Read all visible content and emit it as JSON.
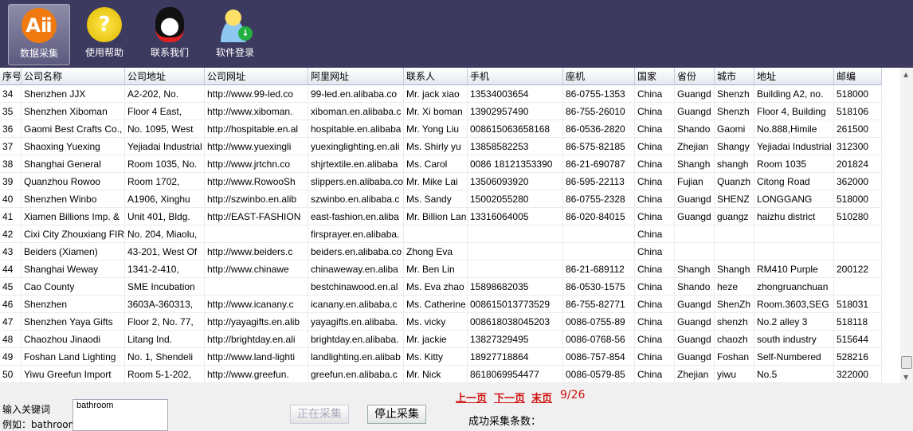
{
  "toolbar": {
    "items": [
      {
        "label": "数据采集",
        "icon": "alibaba-logo-icon"
      },
      {
        "label": "使用帮助",
        "icon": "help-question-icon"
      },
      {
        "label": "联系我们",
        "icon": "qq-penguin-icon"
      },
      {
        "label": "软件登录",
        "icon": "user-login-icon"
      }
    ]
  },
  "table": {
    "columns": [
      "序号",
      "公司名称",
      "公司地址",
      "公司网址",
      "阿里网址",
      "联系人",
      "手机",
      "座机",
      "国家",
      "省份",
      "城市",
      "地址",
      "邮编"
    ],
    "rows": [
      [
        "34",
        "Shenzhen JJX",
        "A2-202, No.",
        "http://www.99-led.co",
        "99-led.en.alibaba.co",
        "Mr. jack xiao",
        "13534003654",
        "86-0755-1353",
        "China",
        "Guangd",
        "Shenzh",
        "Building A2, no.",
        "518000"
      ],
      [
        "35",
        "Shenzhen Xiboman",
        "Floor 4 East,",
        "http://www.xiboman.",
        "xiboman.en.alibaba.c",
        "Mr. Xi boman",
        "13902957490",
        "86-755-26010",
        "China",
        "Guangd",
        "Shenzh",
        "Floor 4, Building",
        "518106"
      ],
      [
        "36",
        "Gaomi Best Crafts Co.,",
        "No. 1095, West",
        "http://hospitable.en.al",
        "hospitable.en.alibaba",
        "Mr. Yong Liu",
        "008615063658168",
        "86-0536-2820",
        "China",
        "Shando",
        "Gaomi",
        "No.888,Himile",
        "261500"
      ],
      [
        "37",
        "Shaoxing Yuexing",
        "Yejiadai Industrial",
        "http://www.yuexingli",
        "yuexinglighting.en.ali",
        "Ms. Shirly yu",
        "13858582253",
        "86-575-82185",
        "China",
        "Zhejian",
        "Shangy",
        "Yejiadai Industrial",
        "312300"
      ],
      [
        "38",
        "Shanghai General",
        "Room 1035, No.",
        "http://www.jrtchn.co",
        "shjrtextile.en.alibaba",
        "Ms. Carol",
        "0086 18121353390",
        "86-21-690787",
        "China",
        "Shangh",
        "shangh",
        "Room 1035",
        "201824"
      ],
      [
        "39",
        "Quanzhou Rowoo",
        "Room 1702,",
        "http://www.RowooSh",
        "slippers.en.alibaba.co",
        "Mr. Mike Lai",
        "13506093920",
        "86-595-22113",
        "China",
        "Fujian",
        "Quanzh",
        "Citong Road",
        "362000"
      ],
      [
        "40",
        "Shenzhen Winbo",
        "A1906, Xinghu",
        "http://szwinbo.en.alib",
        "szwinbo.en.alibaba.c",
        "Ms. Sandy",
        "15002055280",
        "86-0755-2328",
        "China",
        "Guangd",
        "SHENZ",
        "LONGGANG",
        "518000"
      ],
      [
        "41",
        "Xiamen Billions Imp. &",
        "Unit 401, Bldg.",
        "http://EAST-FASHION",
        "east-fashion.en.aliba",
        "Mr. Billion Lan",
        "13316064005",
        "86-020-84015",
        "China",
        "Guangd",
        "guangz",
        "haizhu district",
        "510280"
      ],
      [
        "42",
        "Cixi City Zhouxiang FIR",
        "No. 204, Miaolu,",
        "",
        "firsprayer.en.alibaba.",
        "",
        "",
        "",
        "China",
        "",
        "",
        "",
        ""
      ],
      [
        "43",
        "Beiders (Xiamen)",
        "43-201, West Of",
        "http://www.beiders.c",
        "beiders.en.alibaba.co",
        "Zhong Eva",
        "",
        "",
        "China",
        "",
        "",
        "",
        ""
      ],
      [
        "44",
        "Shanghai Weway",
        "1341-2-410,",
        "http://www.chinawe",
        "chinaweway.en.aliba",
        "Mr. Ben Lin",
        "",
        "86-21-689112",
        "China",
        "Shangh",
        "Shangh",
        "RM410 Purple",
        "200122"
      ],
      [
        "45",
        "Cao County",
        "SME Incubation",
        "",
        "bestchinawood.en.al",
        "Ms. Eva zhao",
        "15898682035",
        "86-0530-1575",
        "China",
        "Shando",
        "heze",
        "zhongruanchuan",
        ""
      ],
      [
        "46",
        "Shenzhen",
        "3603A-360313,",
        "http://www.icanany.c",
        "icanany.en.alibaba.c",
        "Ms. Catherine",
        "008615013773529",
        "86-755-82771",
        "China",
        "Guangd",
        "ShenZh",
        "Room.3603,SEG",
        "518031"
      ],
      [
        "47",
        "Shenzhen Yaya Gifts",
        "Floor 2, No. 77,",
        "http://yayagifts.en.alib",
        "yayagifts.en.alibaba.",
        "Ms. vicky",
        "008618038045203",
        "0086-0755-89",
        "China",
        "Guangd",
        "shenzh",
        "No.2 alley 3",
        "518118"
      ],
      [
        "48",
        "Chaozhou Jinaodi",
        "Litang Ind.",
        "http://brightday.en.ali",
        "brightday.en.alibaba.",
        "Mr. jackie",
        "13827329495",
        "0086-0768-56",
        "China",
        "Guangd",
        "chaozh",
        "south industry",
        "515644"
      ],
      [
        "49",
        "Foshan Land Lighting",
        "No. 1, Shendeli",
        "http://www.land-lighti",
        "landlighting.en.alibab",
        "Ms. Kitty",
        "18927718864",
        "0086-757-854",
        "China",
        "Guangd",
        "Foshan",
        "Self-Numbered",
        "528216"
      ],
      [
        "50",
        "Yiwu Greefun Import",
        "Room 5-1-202,",
        "http://www.greefun.",
        "greefun.en.alibaba.c",
        "Mr. Nick",
        "8618069954477",
        "0086-0579-85",
        "China",
        "Zhejian",
        "yiwu",
        "No.5",
        "322000"
      ]
    ]
  },
  "bottom": {
    "keyword_label": "输入关键词",
    "example_label": "例如：bathroom",
    "keyword_value": "bathroom",
    "collecting_button": "正在采集",
    "stop_button": "停止采集",
    "prev_page": "上一页",
    "next_page": "下一页",
    "last_page": "末页",
    "page_indicator": "9/26",
    "success_count_label": "成功采集条数："
  },
  "colors": {
    "toolbar_bg": "#3d3a5f",
    "link": "#d01010"
  }
}
